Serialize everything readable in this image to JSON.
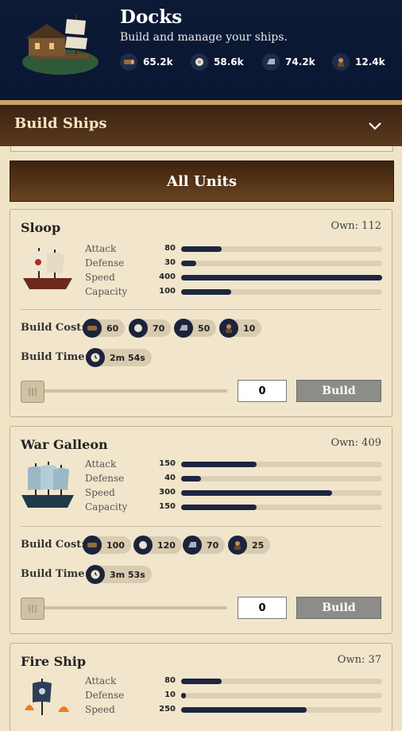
{
  "header": {
    "title": "Docks",
    "subtitle": "Build and manage your ships.",
    "resources": [
      {
        "icon": "wood-icon",
        "value": "65.2k"
      },
      {
        "icon": "cloth-icon",
        "value": "58.6k"
      },
      {
        "icon": "iron-icon",
        "value": "74.2k"
      },
      {
        "icon": "crew-icon",
        "value": "12.4k"
      }
    ]
  },
  "section": {
    "title": "Build Ships",
    "toggle_icon": "chevron-down-icon"
  },
  "tab": {
    "label": "All Units"
  },
  "labels": {
    "attack": "Attack",
    "defense": "Defense",
    "speed": "Speed",
    "capacity": "Capacity",
    "build_cost": "Build Cost:",
    "build_time": "Build Time:",
    "build_button": "Build"
  },
  "stat_max": 400,
  "ships": [
    {
      "name": "Sloop",
      "own": "Own: 112",
      "attack": 80,
      "defense": 30,
      "speed": 400,
      "capacity": 100,
      "cost": {
        "wood": "60",
        "cloth": "70",
        "iron": "50",
        "crew": "10"
      },
      "time": "2m 54s",
      "quantity": "0",
      "slider_fraction": 0
    },
    {
      "name": "War Galleon",
      "own": "Own: 409",
      "attack": 150,
      "defense": 40,
      "speed": 300,
      "capacity": 150,
      "cost": {
        "wood": "100",
        "cloth": "120",
        "iron": "70",
        "crew": "25"
      },
      "time": "3m 53s",
      "quantity": "0",
      "slider_fraction": 0
    },
    {
      "name": "Fire Ship",
      "own": "Own: 37",
      "attack": 80,
      "defense": 10,
      "speed": 250
    }
  ],
  "colors": {
    "header_bg": "#0c1a36",
    "stat_fill": "#1d2540",
    "build_button": "#8c8c88"
  }
}
